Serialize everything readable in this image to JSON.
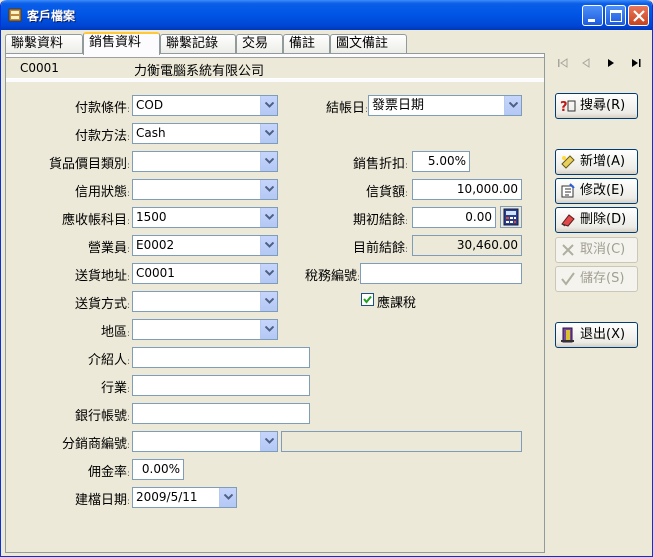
{
  "window": {
    "title": "客戶檔案",
    "colors": {
      "titlebar": "#0055e5",
      "accent": "#ffc83c",
      "face": "#ece9d8"
    }
  },
  "tabs": [
    {
      "label": "聯繫資料"
    },
    {
      "label": "銷售資料"
    },
    {
      "label": "聯繫記錄"
    },
    {
      "label": "交易"
    },
    {
      "label": "備註"
    },
    {
      "label": "圖文備註"
    }
  ],
  "header": {
    "code": "C0001",
    "name": "力衡電腦系統有限公司"
  },
  "form": {
    "payment_terms": {
      "label": "付款條件",
      "value": "COD"
    },
    "payment_method": {
      "label": "付款方法",
      "value": "Cash"
    },
    "price_category": {
      "label": "貨品價目類別",
      "value": ""
    },
    "credit_status": {
      "label": "信用狀態",
      "value": ""
    },
    "ar_account": {
      "label": "應收帳科目",
      "value": "1500"
    },
    "salesperson": {
      "label": "營業員",
      "value": "E0002"
    },
    "ship_address": {
      "label": "送貨地址",
      "value": "C0001"
    },
    "ship_method": {
      "label": "送貨方式",
      "value": ""
    },
    "region": {
      "label": "地區",
      "value": ""
    },
    "referrer": {
      "label": "介紹人",
      "value": ""
    },
    "industry": {
      "label": "行業",
      "value": ""
    },
    "bank_account": {
      "label": "銀行帳號",
      "value": ""
    },
    "distributor_code": {
      "label": "分銷商編號",
      "value": "",
      "extra": ""
    },
    "commission_rate": {
      "label": "佣金率",
      "value": "0.00%"
    },
    "created_date": {
      "label": "建檔日期",
      "value": "2009/5/11"
    },
    "closing_date": {
      "label": "結帳日",
      "value": "發票日期"
    },
    "sales_discount": {
      "label": "銷售折扣",
      "value": "5.00%"
    },
    "credit_limit": {
      "label": "信貨額",
      "value": "10,000.00"
    },
    "opening_balance": {
      "label": "期初結餘",
      "value": "0.00"
    },
    "current_balance": {
      "label": "目前結餘",
      "value": "30,460.00"
    },
    "tax_id": {
      "label": "稅務編號",
      "value": ""
    },
    "taxable": {
      "label": "應課稅",
      "checked": true
    }
  },
  "sidebar": {
    "search": {
      "label": "搜尋(R)"
    },
    "add": {
      "label": "新增(A)"
    },
    "edit": {
      "label": "修改(E)"
    },
    "delete": {
      "label": "刪除(D)"
    },
    "cancel": {
      "label": "取消(C)"
    },
    "save": {
      "label": "儲存(S)"
    },
    "exit": {
      "label": "退出(X)"
    }
  }
}
